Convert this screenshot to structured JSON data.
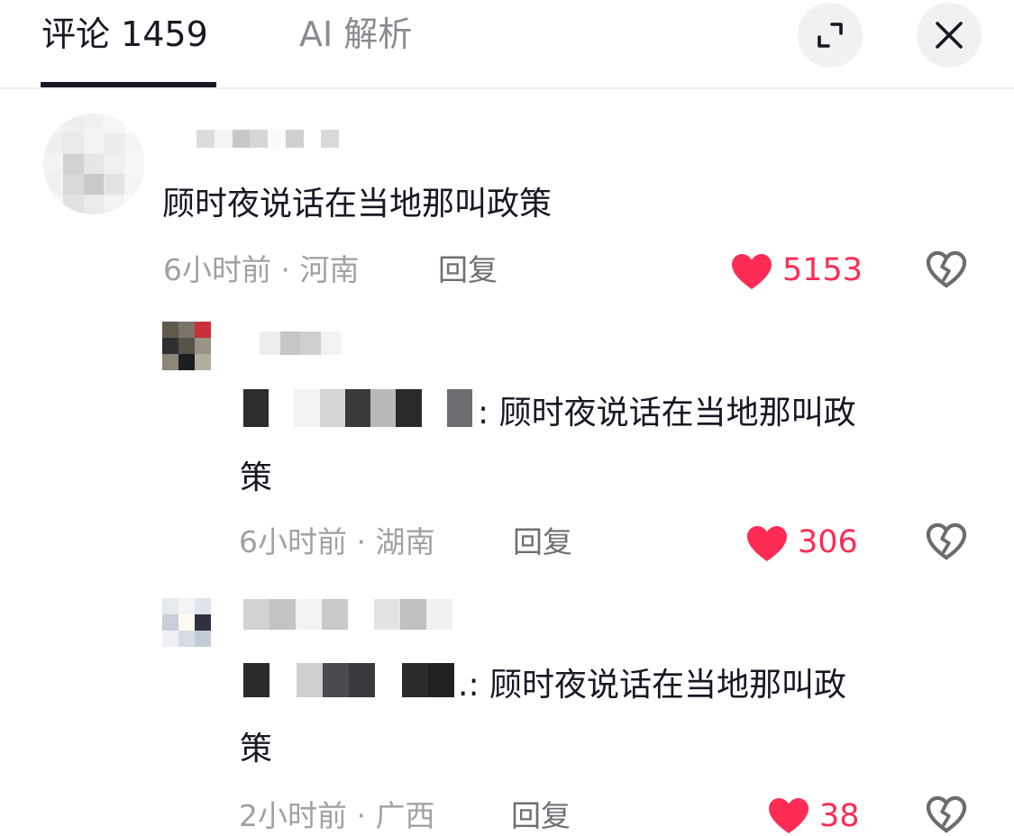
{
  "header": {
    "tab_comments": "评论 1459",
    "tab_ai": "AI 解析",
    "expand_icon": "expand-icon",
    "close_icon": "close-icon"
  },
  "comments": [
    {
      "author": "",
      "text": "顾时夜说话在当地那叫政策",
      "time": "6小时前",
      "location": "河南",
      "meta": "6小时前 · 河南",
      "reply_label": "回复",
      "likes": "5153",
      "liked": true
    },
    {
      "author": "",
      "text_line1": ": 顾时夜说话在当地那叫政",
      "text_line2": "策",
      "time": "6小时前",
      "location": "湖南",
      "meta": "6小时前 · 湖南",
      "reply_label": "回复",
      "likes": "306",
      "liked": true
    },
    {
      "author": "",
      "text_line1": ".: 顾时夜说话在当地那叫政",
      "text_line2": "策",
      "time": "2小时前",
      "location": "广西",
      "meta": "2小时前 · 广西",
      "reply_label": "回复",
      "likes": "38",
      "liked": true
    }
  ],
  "colors": {
    "accent": "#fe2c55",
    "text": "#161823",
    "meta": "#a0a1a6",
    "reply": "#6e6f75"
  }
}
